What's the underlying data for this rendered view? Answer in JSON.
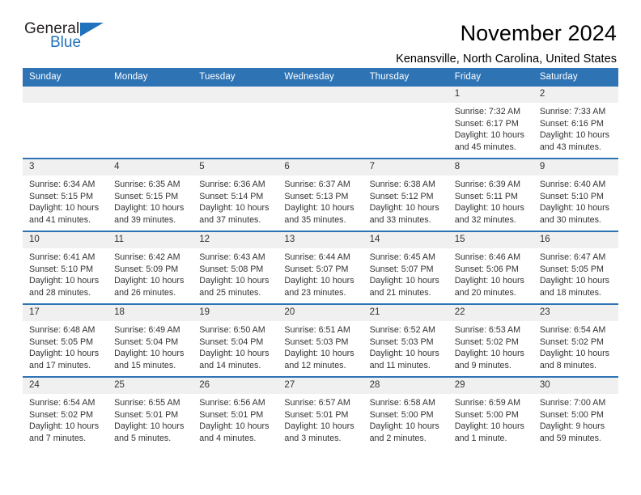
{
  "brand": {
    "name_top": "General",
    "name_bottom": "Blue",
    "accent_color": "#1f72bd"
  },
  "header": {
    "title": "November 2024",
    "subtitle": "Kenansville, North Carolina, United States",
    "header_bg_color": "#2e74b5",
    "daynum_bg_color": "#f0f0f0"
  },
  "weekday_headers": [
    "Sunday",
    "Monday",
    "Tuesday",
    "Wednesday",
    "Thursday",
    "Friday",
    "Saturday"
  ],
  "labels": {
    "sunrise_prefix": "Sunrise:",
    "sunset_prefix": "Sunset:",
    "daylight_prefix": "Daylight:"
  },
  "weeks": [
    [
      {
        "day": "",
        "sunrise": "",
        "sunset": "",
        "daylight": ""
      },
      {
        "day": "",
        "sunrise": "",
        "sunset": "",
        "daylight": ""
      },
      {
        "day": "",
        "sunrise": "",
        "sunset": "",
        "daylight": ""
      },
      {
        "day": "",
        "sunrise": "",
        "sunset": "",
        "daylight": ""
      },
      {
        "day": "",
        "sunrise": "",
        "sunset": "",
        "daylight": ""
      },
      {
        "day": "1",
        "sunrise": "Sunrise: 7:32 AM",
        "sunset": "Sunset: 6:17 PM",
        "daylight": "Daylight: 10 hours and 45 minutes."
      },
      {
        "day": "2",
        "sunrise": "Sunrise: 7:33 AM",
        "sunset": "Sunset: 6:16 PM",
        "daylight": "Daylight: 10 hours and 43 minutes."
      }
    ],
    [
      {
        "day": "3",
        "sunrise": "Sunrise: 6:34 AM",
        "sunset": "Sunset: 5:15 PM",
        "daylight": "Daylight: 10 hours and 41 minutes."
      },
      {
        "day": "4",
        "sunrise": "Sunrise: 6:35 AM",
        "sunset": "Sunset: 5:15 PM",
        "daylight": "Daylight: 10 hours and 39 minutes."
      },
      {
        "day": "5",
        "sunrise": "Sunrise: 6:36 AM",
        "sunset": "Sunset: 5:14 PM",
        "daylight": "Daylight: 10 hours and 37 minutes."
      },
      {
        "day": "6",
        "sunrise": "Sunrise: 6:37 AM",
        "sunset": "Sunset: 5:13 PM",
        "daylight": "Daylight: 10 hours and 35 minutes."
      },
      {
        "day": "7",
        "sunrise": "Sunrise: 6:38 AM",
        "sunset": "Sunset: 5:12 PM",
        "daylight": "Daylight: 10 hours and 33 minutes."
      },
      {
        "day": "8",
        "sunrise": "Sunrise: 6:39 AM",
        "sunset": "Sunset: 5:11 PM",
        "daylight": "Daylight: 10 hours and 32 minutes."
      },
      {
        "day": "9",
        "sunrise": "Sunrise: 6:40 AM",
        "sunset": "Sunset: 5:10 PM",
        "daylight": "Daylight: 10 hours and 30 minutes."
      }
    ],
    [
      {
        "day": "10",
        "sunrise": "Sunrise: 6:41 AM",
        "sunset": "Sunset: 5:10 PM",
        "daylight": "Daylight: 10 hours and 28 minutes."
      },
      {
        "day": "11",
        "sunrise": "Sunrise: 6:42 AM",
        "sunset": "Sunset: 5:09 PM",
        "daylight": "Daylight: 10 hours and 26 minutes."
      },
      {
        "day": "12",
        "sunrise": "Sunrise: 6:43 AM",
        "sunset": "Sunset: 5:08 PM",
        "daylight": "Daylight: 10 hours and 25 minutes."
      },
      {
        "day": "13",
        "sunrise": "Sunrise: 6:44 AM",
        "sunset": "Sunset: 5:07 PM",
        "daylight": "Daylight: 10 hours and 23 minutes."
      },
      {
        "day": "14",
        "sunrise": "Sunrise: 6:45 AM",
        "sunset": "Sunset: 5:07 PM",
        "daylight": "Daylight: 10 hours and 21 minutes."
      },
      {
        "day": "15",
        "sunrise": "Sunrise: 6:46 AM",
        "sunset": "Sunset: 5:06 PM",
        "daylight": "Daylight: 10 hours and 20 minutes."
      },
      {
        "day": "16",
        "sunrise": "Sunrise: 6:47 AM",
        "sunset": "Sunset: 5:05 PM",
        "daylight": "Daylight: 10 hours and 18 minutes."
      }
    ],
    [
      {
        "day": "17",
        "sunrise": "Sunrise: 6:48 AM",
        "sunset": "Sunset: 5:05 PM",
        "daylight": "Daylight: 10 hours and 17 minutes."
      },
      {
        "day": "18",
        "sunrise": "Sunrise: 6:49 AM",
        "sunset": "Sunset: 5:04 PM",
        "daylight": "Daylight: 10 hours and 15 minutes."
      },
      {
        "day": "19",
        "sunrise": "Sunrise: 6:50 AM",
        "sunset": "Sunset: 5:04 PM",
        "daylight": "Daylight: 10 hours and 14 minutes."
      },
      {
        "day": "20",
        "sunrise": "Sunrise: 6:51 AM",
        "sunset": "Sunset: 5:03 PM",
        "daylight": "Daylight: 10 hours and 12 minutes."
      },
      {
        "day": "21",
        "sunrise": "Sunrise: 6:52 AM",
        "sunset": "Sunset: 5:03 PM",
        "daylight": "Daylight: 10 hours and 11 minutes."
      },
      {
        "day": "22",
        "sunrise": "Sunrise: 6:53 AM",
        "sunset": "Sunset: 5:02 PM",
        "daylight": "Daylight: 10 hours and 9 minutes."
      },
      {
        "day": "23",
        "sunrise": "Sunrise: 6:54 AM",
        "sunset": "Sunset: 5:02 PM",
        "daylight": "Daylight: 10 hours and 8 minutes."
      }
    ],
    [
      {
        "day": "24",
        "sunrise": "Sunrise: 6:54 AM",
        "sunset": "Sunset: 5:02 PM",
        "daylight": "Daylight: 10 hours and 7 minutes."
      },
      {
        "day": "25",
        "sunrise": "Sunrise: 6:55 AM",
        "sunset": "Sunset: 5:01 PM",
        "daylight": "Daylight: 10 hours and 5 minutes."
      },
      {
        "day": "26",
        "sunrise": "Sunrise: 6:56 AM",
        "sunset": "Sunset: 5:01 PM",
        "daylight": "Daylight: 10 hours and 4 minutes."
      },
      {
        "day": "27",
        "sunrise": "Sunrise: 6:57 AM",
        "sunset": "Sunset: 5:01 PM",
        "daylight": "Daylight: 10 hours and 3 minutes."
      },
      {
        "day": "28",
        "sunrise": "Sunrise: 6:58 AM",
        "sunset": "Sunset: 5:00 PM",
        "daylight": "Daylight: 10 hours and 2 minutes."
      },
      {
        "day": "29",
        "sunrise": "Sunrise: 6:59 AM",
        "sunset": "Sunset: 5:00 PM",
        "daylight": "Daylight: 10 hours and 1 minute."
      },
      {
        "day": "30",
        "sunrise": "Sunrise: 7:00 AM",
        "sunset": "Sunset: 5:00 PM",
        "daylight": "Daylight: 9 hours and 59 minutes."
      }
    ]
  ]
}
